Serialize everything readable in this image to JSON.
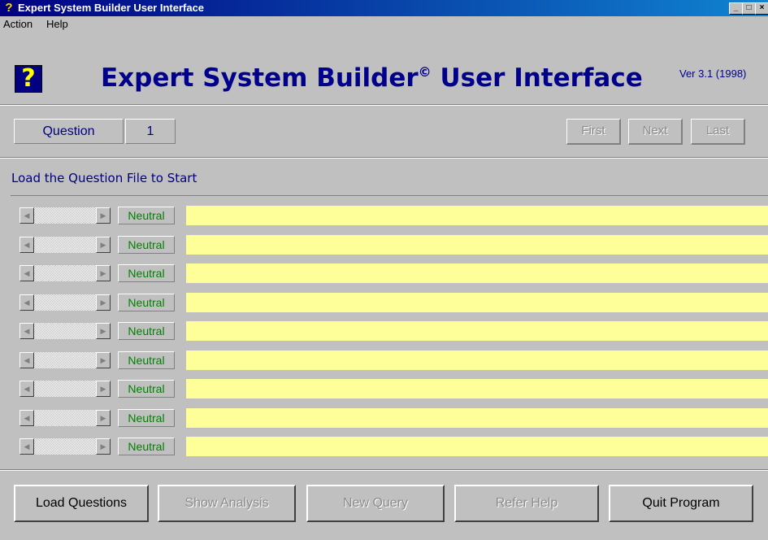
{
  "window": {
    "title": "Expert System Builder User Interface",
    "min": "_",
    "max": "□",
    "close": "×"
  },
  "menu": {
    "items": [
      "Action",
      "Help"
    ]
  },
  "header": {
    "title": "Expert System Builder",
    "copyright": "©",
    "title_tail": " User Interface",
    "version": "Ver 3.1 (1998)",
    "logo_glyph": "?"
  },
  "question": {
    "label": "Question",
    "number": "1"
  },
  "nav": {
    "first": "First",
    "next": "Next",
    "last": "Last"
  },
  "status": "Load the Question File to Start",
  "rows": [
    {
      "rating": "Neutral",
      "answer": ""
    },
    {
      "rating": "Neutral",
      "answer": ""
    },
    {
      "rating": "Neutral",
      "answer": ""
    },
    {
      "rating": "Neutral",
      "answer": ""
    },
    {
      "rating": "Neutral",
      "answer": ""
    },
    {
      "rating": "Neutral",
      "answer": ""
    },
    {
      "rating": "Neutral",
      "answer": ""
    },
    {
      "rating": "Neutral",
      "answer": ""
    },
    {
      "rating": "Neutral",
      "answer": ""
    }
  ],
  "scroll": {
    "left_arrow": "◀",
    "right_arrow": "▶"
  },
  "buttons": {
    "load": "Load Questions",
    "analysis": "Show Analysis",
    "new_query": "New Query",
    "refer_help": "Refer Help",
    "quit": "Quit Program"
  },
  "icons": {
    "app": "question-icon",
    "logo": "help-question-icon"
  }
}
